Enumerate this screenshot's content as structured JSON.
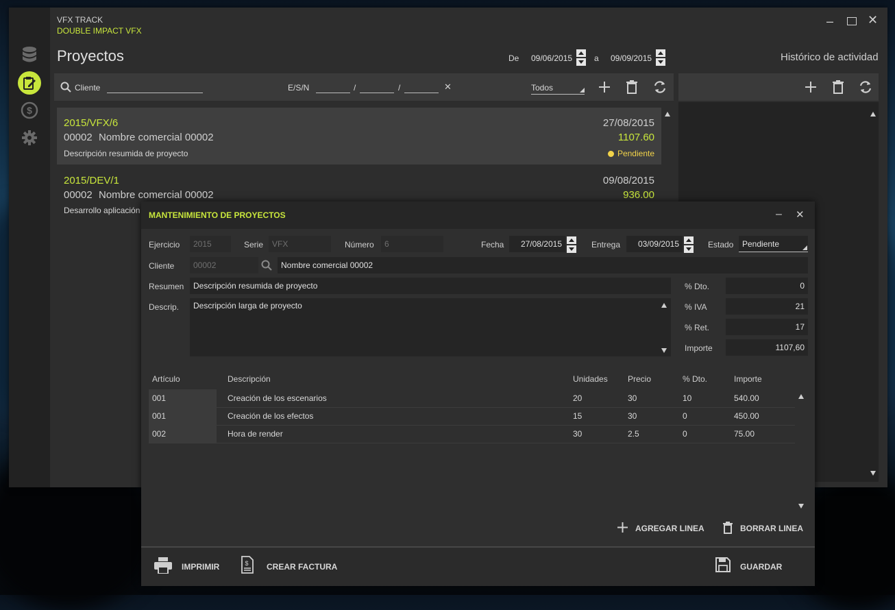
{
  "app": {
    "name": "VFX TRACK",
    "company": "DOUBLE IMPACT VFX"
  },
  "sidebar": {
    "items": [
      {
        "icon": "database-icon"
      },
      {
        "icon": "projects-edit-icon",
        "active": true
      },
      {
        "icon": "dollar-icon"
      },
      {
        "icon": "gear-icon"
      }
    ]
  },
  "page": {
    "title": "Proyectos"
  },
  "date_filter": {
    "from_label": "De",
    "from": "09/06/2015",
    "to_label": "a",
    "to": "09/09/2015"
  },
  "activity": {
    "title": "Histórico de actividad"
  },
  "filterbar": {
    "client_label": "Cliente",
    "esn_label": "E/S/N",
    "sep": "/",
    "clear": "✕",
    "status_value": "Todos"
  },
  "projects": [
    {
      "code": "2015/VFX/6",
      "date": "27/08/2015",
      "client_id": "00002",
      "client_name": "Nombre comercial 00002",
      "amount": "1107.60",
      "summary": "Descripción resumida de proyecto",
      "status": "Pendiente"
    },
    {
      "code": "2015/DEV/1",
      "date": "09/08/2015",
      "client_id": "00002",
      "client_name": "Nombre comercial 00002",
      "amount": "936.00",
      "summary": "Desarrollo aplicación"
    }
  ],
  "dialog": {
    "title": "MANTENIMIENTO DE PROYECTOS",
    "ejercicio_label": "Ejercicio",
    "ejercicio": "2015",
    "serie_label": "Serie",
    "serie": "VFX",
    "numero_label": "Número",
    "numero": "6",
    "fecha_label": "Fecha",
    "fecha": "27/08/2015",
    "entrega_label": "Entrega",
    "entrega": "03/09/2015",
    "estado_label": "Estado",
    "estado": "Pendiente",
    "cliente_label": "Cliente",
    "cliente_id": "00002",
    "cliente_name": "Nombre comercial 00002",
    "resumen_label": "Resumen",
    "resumen": "Descripción resumida de proyecto",
    "descrip_label": "Descrip.",
    "descrip": "Descripción larga de proyecto",
    "dto_label": "% Dto.",
    "dto": "0",
    "iva_label": "% IVA",
    "iva": "21",
    "ret_label": "% Ret.",
    "ret": "17",
    "importe_label": "Importe",
    "importe": "1107,60",
    "table": {
      "headers": [
        "Artículo",
        "Descripción",
        "Unidades",
        "Precio",
        "% Dto.",
        "Importe"
      ],
      "rows": [
        [
          "001",
          "Creación de los escenarios",
          "20",
          "30",
          "10",
          "540.00"
        ],
        [
          "001",
          "Creación de los efectos",
          "15",
          "30",
          "0",
          "450.00"
        ],
        [
          "002",
          "Hora de render",
          "30",
          "2.5",
          "0",
          "75.00"
        ]
      ]
    },
    "add_line": "AGREGAR LINEA",
    "delete_line": "BORRAR LINEA",
    "print": "IMPRIMIR",
    "invoice": "CREAR FACTURA",
    "save": "GUARDAR"
  },
  "colors": {
    "accent": "#c8e63c",
    "status_dot": "#f2d34a"
  }
}
